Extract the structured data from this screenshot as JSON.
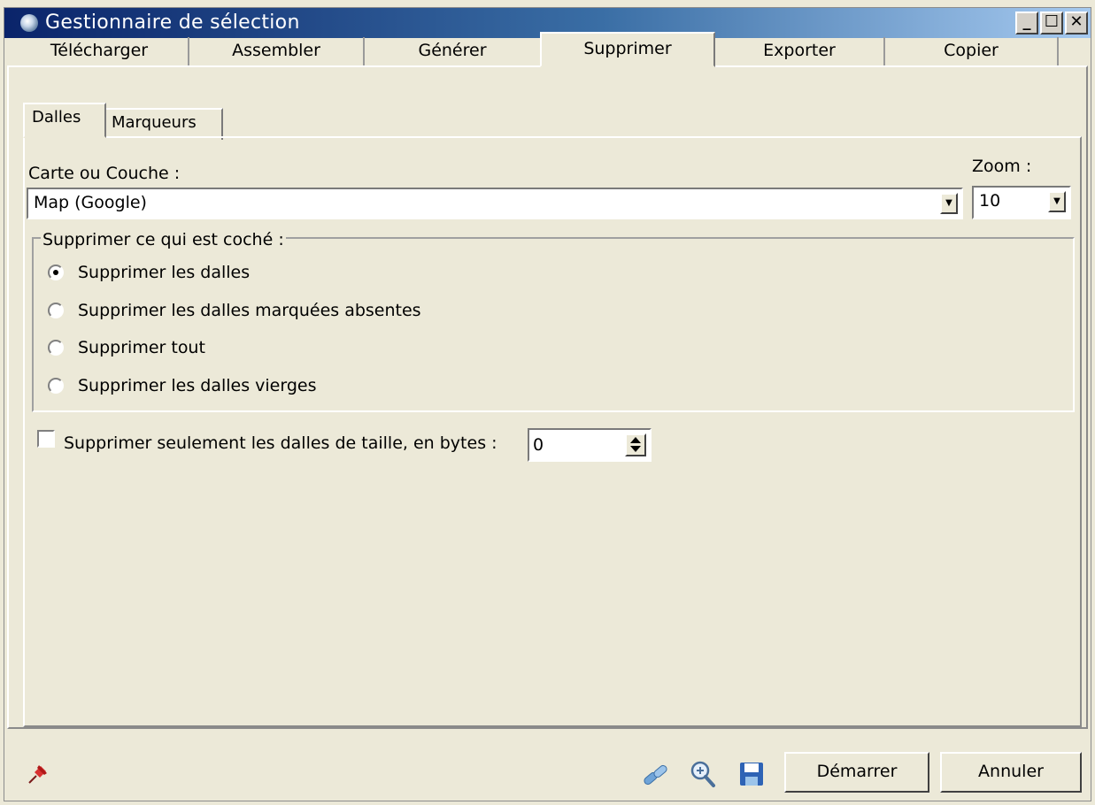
{
  "window": {
    "title": "Gestionnaire de sélection",
    "minimize_label": "_",
    "maximize_label": "☐",
    "close_label": "✕"
  },
  "main_tabs": [
    {
      "label": "Télécharger",
      "active": false
    },
    {
      "label": "Assembler",
      "active": false
    },
    {
      "label": "Générer",
      "active": false
    },
    {
      "label": "Supprimer",
      "active": true
    },
    {
      "label": "Exporter",
      "active": false
    },
    {
      "label": "Copier",
      "active": false
    }
  ],
  "sub_tabs": [
    {
      "label": "Dalles",
      "active": true
    },
    {
      "label": "Marqueurs",
      "active": false
    }
  ],
  "form": {
    "map_label": "Carte ou Couche :",
    "map_value": "Map (Google)",
    "zoom_label": "Zoom :",
    "zoom_value": "10",
    "group_label": "Supprimer ce qui est coché :",
    "options": [
      {
        "label": "Supprimer les dalles",
        "checked": true
      },
      {
        "label": "Supprimer les dalles marquées absentes",
        "checked": false
      },
      {
        "label": "Supprimer tout",
        "checked": false
      },
      {
        "label": "Supprimer les dalles vierges",
        "checked": false
      }
    ],
    "size_filter_label": "Supprimer seulement les dalles de taille, en bytes :",
    "size_filter_checked": false,
    "size_value": "0"
  },
  "footer": {
    "start_label": "Démarrer",
    "cancel_label": "Annuler",
    "icons": [
      "pin-icon",
      "link-icon",
      "zoom-icon",
      "save-icon"
    ]
  },
  "colors": {
    "titlebar_start": "#0a246a",
    "titlebar_end": "#a6caf0",
    "window_bg": "#ece9d8"
  }
}
